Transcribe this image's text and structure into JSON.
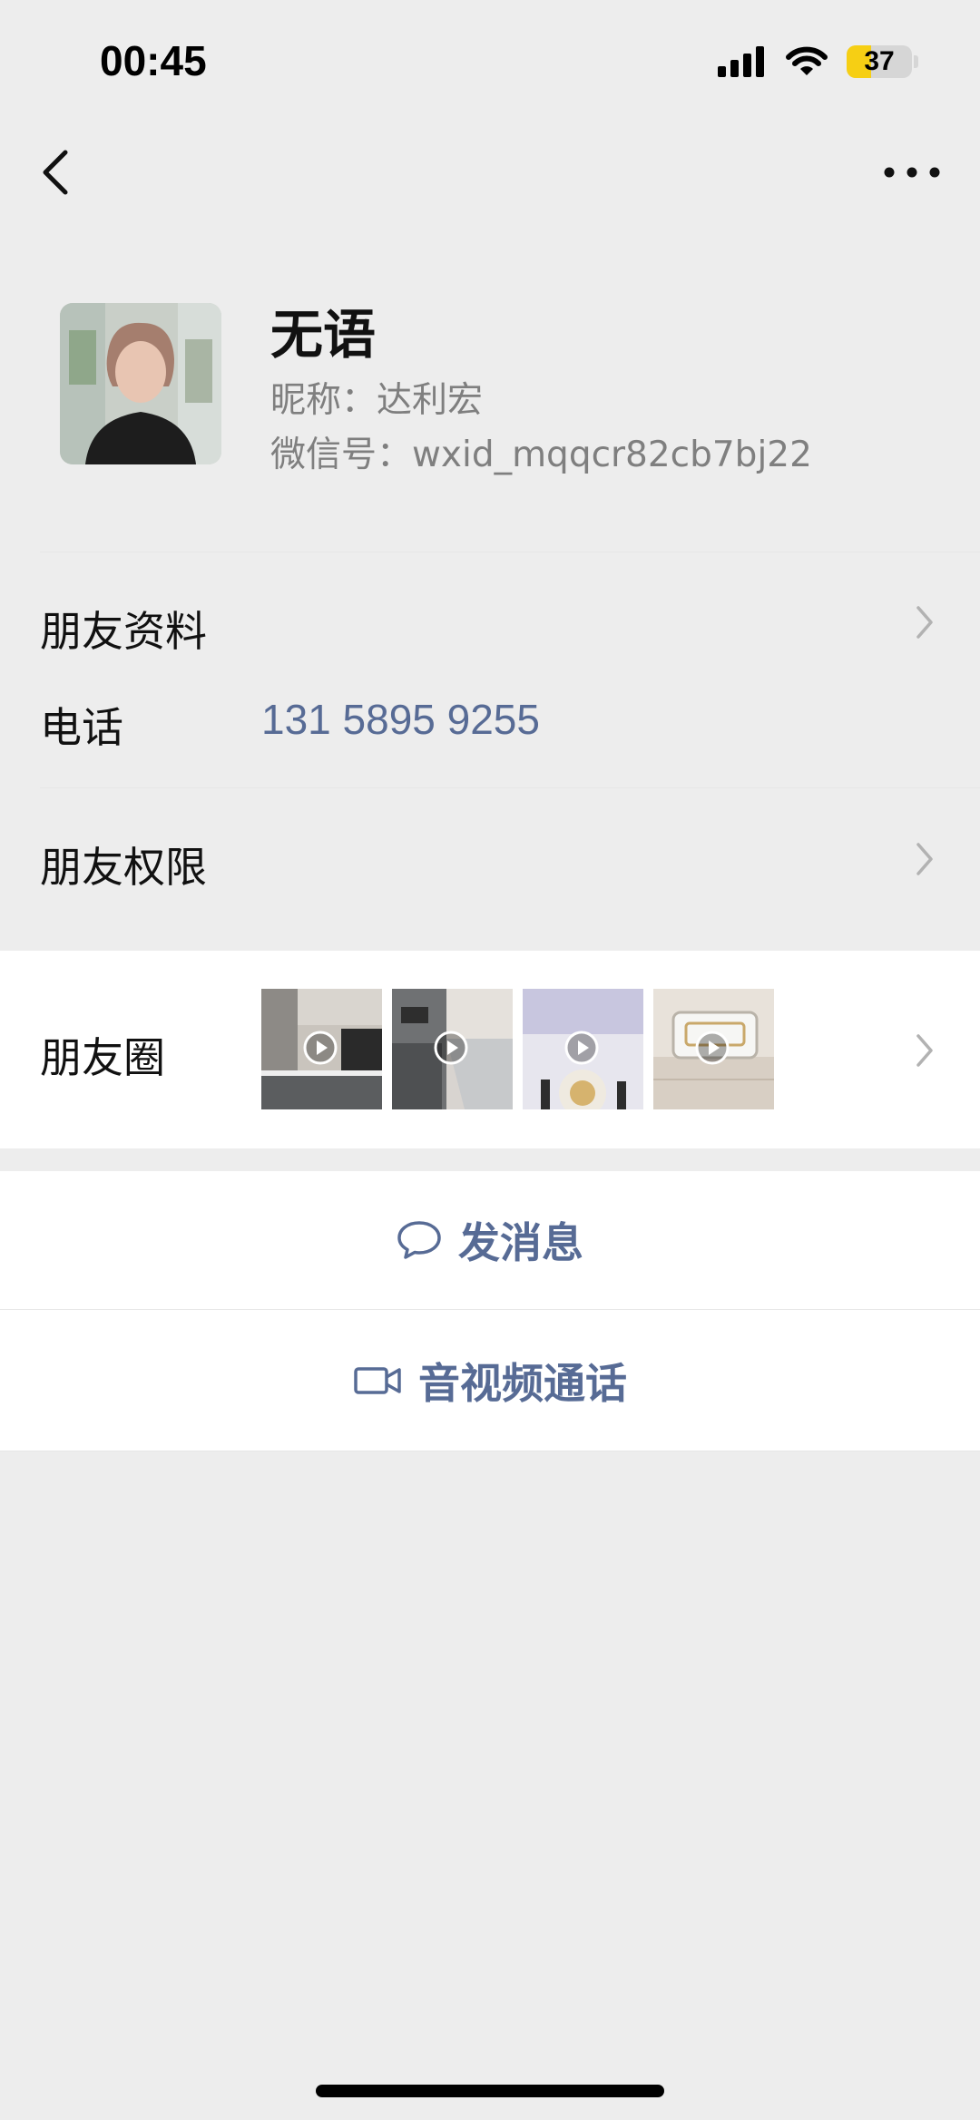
{
  "status_bar": {
    "time": "00:45",
    "battery_level": "37",
    "battery_fraction": 0.37
  },
  "profile": {
    "display_name": "无语",
    "nickname": "昵称：达利宏",
    "wechat_id": "微信号：wxid_mqqcr82cb7bj22"
  },
  "rows": {
    "friend_info_label": "朋友资料",
    "phone_label": "电话",
    "phone_value": "131 5895 9255",
    "permissions_label": "朋友权限",
    "moments_label": "朋友圈"
  },
  "moments_thumbnails": [
    {
      "name": "kitchen-cabinets",
      "video": true
    },
    {
      "name": "kitchen-corridor",
      "video": true
    },
    {
      "name": "light-fixture",
      "video": true
    },
    {
      "name": "ceiling-light",
      "video": true
    }
  ],
  "actions": {
    "send_message": "发消息",
    "video_call": "音视频通话"
  },
  "colors": {
    "link": "#576b95",
    "background": "#ededed",
    "battery": "#f6cf14"
  }
}
